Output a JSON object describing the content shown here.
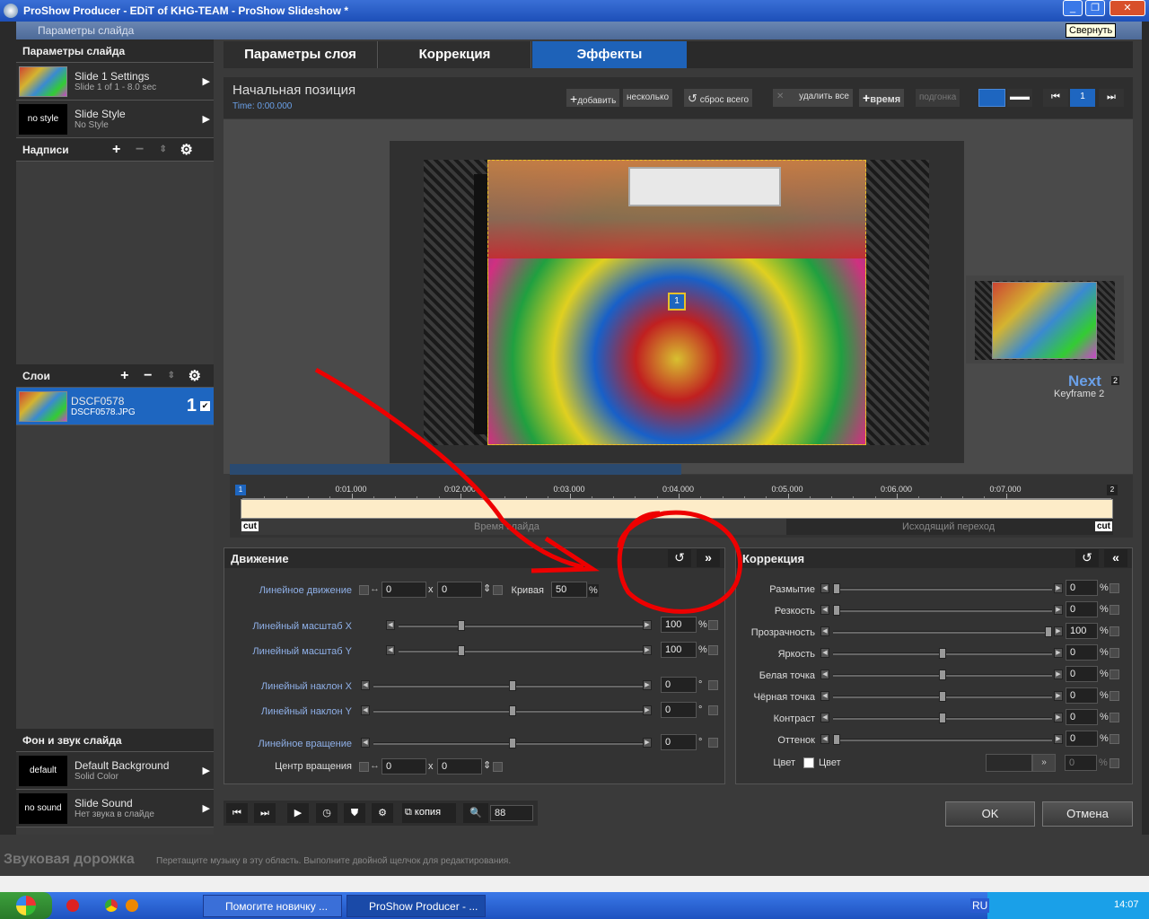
{
  "app": {
    "title": "ProShow Producer - EDiT of KHG-TEAM - ProShow Slideshow *",
    "dialog_title": "Параметры слайда",
    "tooltip": "Свернуть"
  },
  "left": {
    "slide_params_header": "Параметры слайда",
    "slide_settings": {
      "title": "Slide 1 Settings",
      "sub": "Slide 1 of 1 - 8.0 sec"
    },
    "slide_style": {
      "thumb": "no style",
      "title": "Slide Style",
      "sub": "No Style"
    },
    "captions_header": "Надписи",
    "layers_header": "Слои",
    "layer": {
      "title": "DSCF0578",
      "sub": "DSCF0578.JPG",
      "index": "1"
    },
    "bg_header": "Фон и звук слайда",
    "background": {
      "thumb": "default",
      "title": "Default Background",
      "sub": "Solid Color"
    },
    "sound": {
      "thumb": "no sound",
      "title": "Slide Sound",
      "sub": "Нет звука в слайде"
    }
  },
  "tabs": [
    "Параметры слоя",
    "Коррекция",
    "Эффекты"
  ],
  "keyframe": {
    "title": "Начальная позиция",
    "time": "Time: 0:00.000",
    "add": "добавить",
    "several": "несколько",
    "reset_all": "сброс всего",
    "delete_all": "удалить все",
    "time_btn": "время",
    "fit": "подгонка",
    "marker": "1"
  },
  "next": {
    "label": "Next",
    "sub": "Keyframe 2",
    "num": "2"
  },
  "timeline": {
    "ticks": [
      "0:01.000",
      "0:02.000",
      "0:03.000",
      "0:04.000",
      "0:05.000",
      "0:06.000",
      "0:07.000"
    ],
    "slide_time": "Время слайда",
    "out_transition": "Исходящий переход",
    "cut": "cut",
    "start_marker": "1",
    "end_marker": "2"
  },
  "motion": {
    "header": "Движение",
    "linear_motion": "Линейное движение",
    "pos_x": "0",
    "pos_y": "0",
    "x_sep": "x",
    "curve": "Кривая",
    "curve_val": "50",
    "pct": "%",
    "deg": "°",
    "scale_x": "Линейный масштаб X",
    "scale_x_val": "100",
    "scale_y": "Линейный масштаб Y",
    "scale_y_val": "100",
    "tilt_x": "Линейный наклон X",
    "tilt_x_val": "0",
    "tilt_y": "Линейный наклон Y",
    "tilt_y_val": "0",
    "rotation": "Линейное вращение",
    "rotation_val": "0",
    "center": "Центр вращения",
    "center_x": "0",
    "center_y": "0"
  },
  "correction": {
    "header": "Коррекция",
    "rows": [
      {
        "label": "Размытие",
        "value": "0",
        "level": 0.0
      },
      {
        "label": "Резкость",
        "value": "0",
        "level": 0.0
      },
      {
        "label": "Прозрачность",
        "value": "100",
        "level": 1.0
      },
      {
        "label": "Яркость",
        "value": "0",
        "level": 0.5
      },
      {
        "label": "Белая точка",
        "value": "0",
        "level": 0.5
      },
      {
        "label": "Чёрная точка",
        "value": "0",
        "level": 0.5
      },
      {
        "label": "Контраст",
        "value": "0",
        "level": 0.5
      },
      {
        "label": "Оттенок",
        "value": "0",
        "level": 0.0
      }
    ],
    "color_label": "Цвет",
    "color_chk": "Цвет",
    "color_val": "0"
  },
  "bottom": {
    "copy": "копия",
    "zoom": "88",
    "ok": "OK",
    "cancel": "Отмена"
  },
  "soundtrack": {
    "title": "Звуковая дорожка",
    "hint": "Перетащите музыку в эту область. Выполните двойной щелчок для редактирования."
  },
  "taskbar": {
    "task1": "Помогите новичку ...",
    "task2": "ProShow Producer - ...",
    "lang": "RU",
    "clock": "14:07"
  }
}
